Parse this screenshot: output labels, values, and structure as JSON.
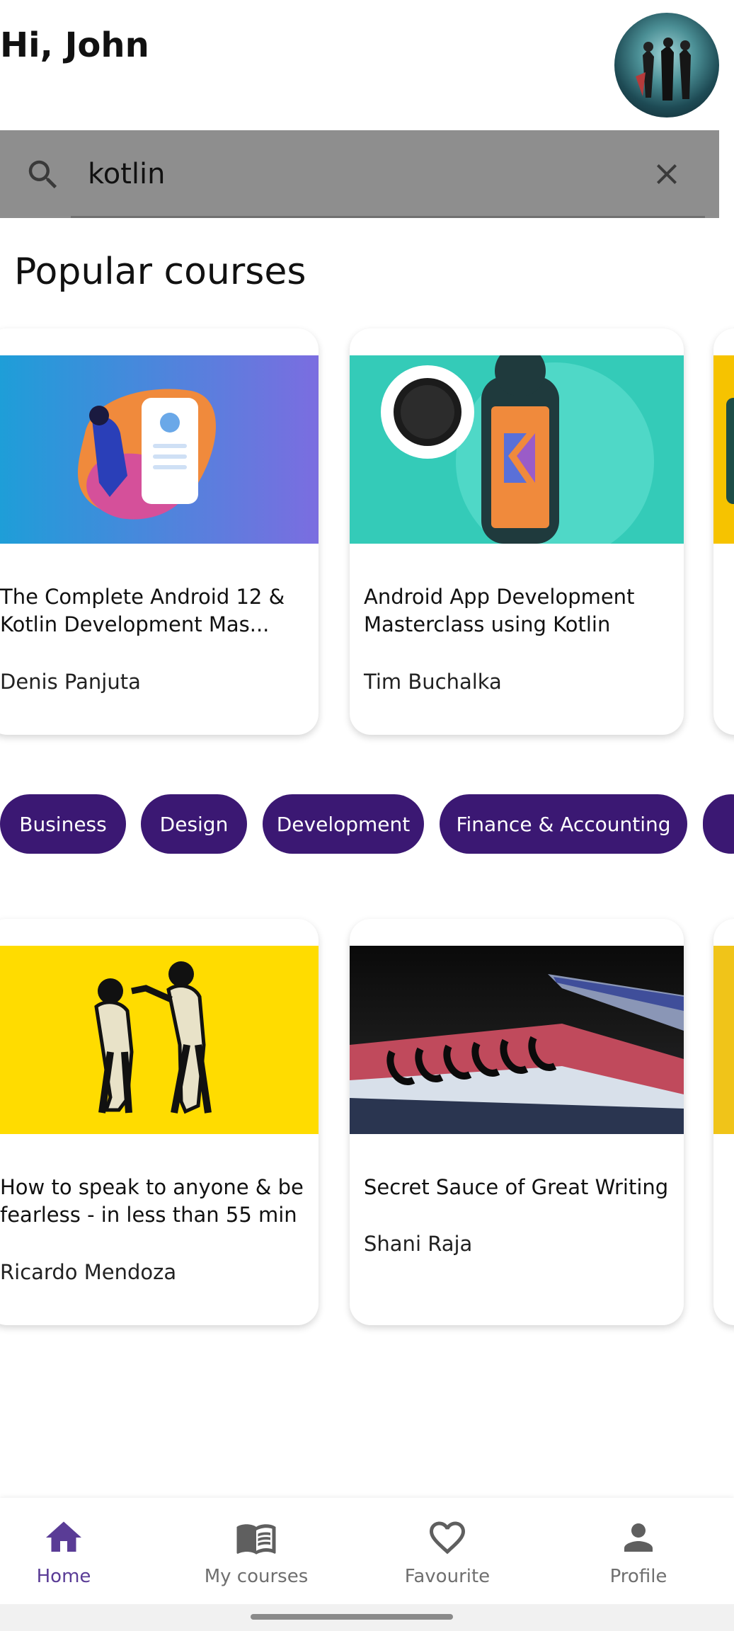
{
  "header": {
    "greeting": "Hi, John"
  },
  "search": {
    "value": "kotlin",
    "placeholder": ""
  },
  "section_title": "Popular courses",
  "popular_courses": [
    {
      "title": "The Complete Android 12 & Kotlin Development Mas...",
      "author": "Denis Panjuta"
    },
    {
      "title": "Android App Development Masterclass using Kotlin",
      "author": "Tim Buchalka"
    }
  ],
  "categories": [
    "Business",
    "Design",
    "Development",
    "Finance & Accounting"
  ],
  "more_courses": [
    {
      "title": "How to speak to anyone & be fearless - in less than 55 min",
      "author": "Ricardo Mendoza"
    },
    {
      "title": "Secret Sauce of Great Writing",
      "author": "Shani Raja"
    }
  ],
  "bottom_nav": {
    "items": [
      {
        "label": "Home",
        "icon": "home-icon",
        "active": true
      },
      {
        "label": "My courses",
        "icon": "book-icon",
        "active": false
      },
      {
        "label": "Favourite",
        "icon": "heart-icon",
        "active": false
      },
      {
        "label": "Profile",
        "icon": "person-icon",
        "active": false
      }
    ]
  },
  "colors": {
    "accent": "#3b1873",
    "active_nav": "#5a3c96",
    "search_bg": "#8e8e8e"
  }
}
